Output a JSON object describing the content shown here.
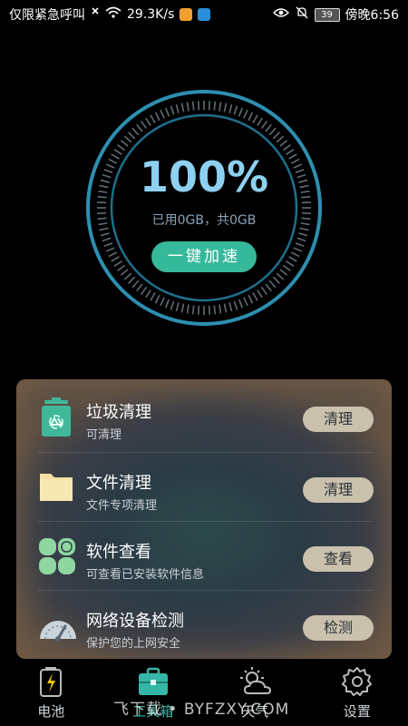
{
  "status_bar": {
    "carrier": "仅限紧急呼叫",
    "speed": "29.3K/s",
    "battery": "39",
    "time": "傍晚6:56",
    "icons": [
      "signal-off-icon",
      "wifi-icon",
      "app-notification-icon",
      "app-notification-icon",
      "eye-icon",
      "mute-bell-icon",
      "battery-icon"
    ]
  },
  "dial": {
    "percent": "100%",
    "usage": "已用0GB，共0GB",
    "boost_label": "一键加速",
    "colors": {
      "ring": "#2d8fb0",
      "accent": "#36b99a"
    }
  },
  "tools": [
    {
      "icon": "trash-recycle-icon",
      "title": "垃圾清理",
      "subtitle": "可清理",
      "button": "清理"
    },
    {
      "icon": "folder-icon",
      "title": "文件清理",
      "subtitle": "文件专项清理",
      "button": "清理"
    },
    {
      "icon": "apps-grid-icon",
      "title": "软件查看",
      "subtitle": "可查看已安装软件信息",
      "button": "查看"
    },
    {
      "icon": "speed-gauge-icon",
      "title": "网络设备检测",
      "subtitle": "保护您的上网安全",
      "button": "检测"
    }
  ],
  "nav": [
    {
      "icon": "battery-icon",
      "label": "电池"
    },
    {
      "icon": "toolbox-icon",
      "label": "工具箱",
      "active": true
    },
    {
      "icon": "weather-icon",
      "label": "天气"
    },
    {
      "icon": "gear-icon",
      "label": "设置"
    }
  ],
  "watermark": "飞下载 • BYFZXY.COM"
}
